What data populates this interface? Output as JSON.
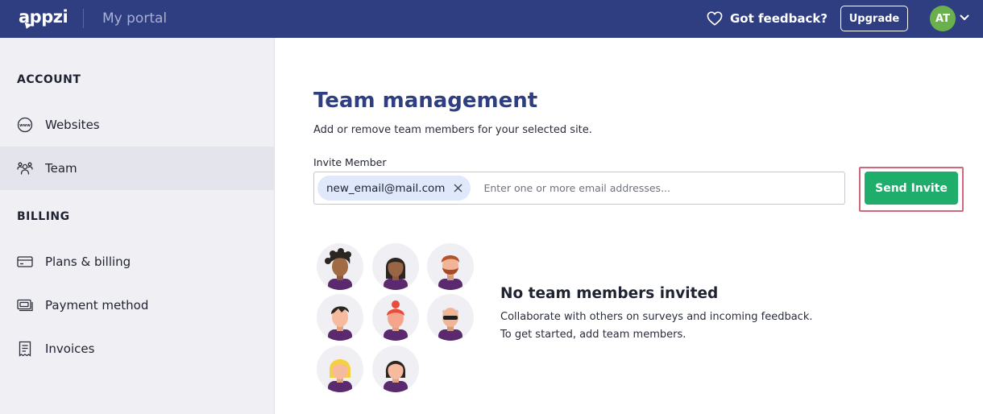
{
  "header": {
    "logo_text": "appzi",
    "portal_title": "My portal",
    "feedback_label": "Got feedback?",
    "upgrade_label": "Upgrade",
    "avatar_initials": "AT"
  },
  "sidebar": {
    "account_heading": "ACCOUNT",
    "billing_heading": "BILLING",
    "items": [
      {
        "label": "Websites",
        "icon": "www-icon",
        "active": false
      },
      {
        "label": "Team",
        "icon": "team-icon",
        "active": true
      },
      {
        "label": "Plans & billing",
        "icon": "credit-card-icon",
        "active": false
      },
      {
        "label": "Payment method",
        "icon": "payment-icon",
        "active": false
      },
      {
        "label": "Invoices",
        "icon": "invoice-icon",
        "active": false
      }
    ]
  },
  "main": {
    "title": "Team management",
    "subtitle": "Add or remove team members for your selected site.",
    "invite_label": "Invite Member",
    "chip_email": "new_email@mail.com",
    "input_placeholder": "Enter one or more email addresses...",
    "send_label": "Send Invite"
  },
  "empty_state": {
    "title": "No team members invited",
    "line1": "Collaborate with others on surveys and incoming feedback.",
    "line2": "To get started, add team members."
  },
  "colors": {
    "topbar": "#2f3e80",
    "accent_green": "#1fad6b",
    "highlight": "#d2677a",
    "chip_bg": "#dfe9fb",
    "avatar_green": "#6ab04c"
  }
}
